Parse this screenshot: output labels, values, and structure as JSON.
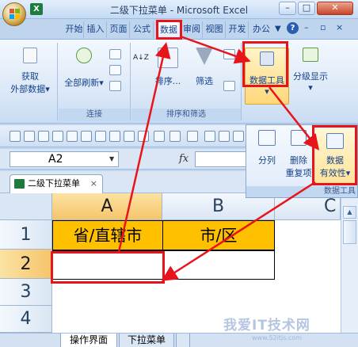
{
  "window": {
    "title": "二级下拉菜单 - Microsoft Excel",
    "min_glyph": "–",
    "max_glyph": "□",
    "close_glyph": "✕",
    "qat_glyph": "X"
  },
  "ribbon_tabs": [
    {
      "label": "开始"
    },
    {
      "label": "插入"
    },
    {
      "label": "页面"
    },
    {
      "label": "公式"
    },
    {
      "label": "数据",
      "active": true
    },
    {
      "label": "审阅"
    },
    {
      "label": "视图"
    },
    {
      "label": "开发"
    },
    {
      "label": "办公"
    }
  ],
  "tab_more_glyph": "▼",
  "help_glyph": "?",
  "tab_controls": {
    "min": "–",
    "restore": "▫",
    "close": "×"
  },
  "ribbon": {
    "get_data": {
      "line1": "获取",
      "line2": "外部数据",
      "arrow": "▾"
    },
    "refresh_all": {
      "label": "全部刷新",
      "arrow": "▾"
    },
    "connections_group": "连接",
    "sort_az": "A↓Z",
    "sort_label": "排序...",
    "filter_label": "筛选",
    "sort_filter_group": "排序和筛选",
    "data_tools": {
      "label": "数据工具",
      "arrow": "▾"
    },
    "outline": {
      "label": "分级显示",
      "arrow": "▾"
    }
  },
  "name_box": {
    "value": "A2",
    "arrow": "▼"
  },
  "formula_bar": {
    "fx": "fx",
    "value": ""
  },
  "workbook_tab": {
    "label": "二级下拉菜单",
    "close": "×"
  },
  "data_tools_panel": {
    "text_to_columns": "分列",
    "remove_duplicates_line1": "删除",
    "remove_duplicates_line2": "重复项",
    "data_validation_line1": "数据",
    "data_validation_line2": "有效性",
    "data_validation_arrow": "▾",
    "group_label": "数据工具"
  },
  "grid": {
    "columns": [
      "A",
      "B",
      "C"
    ],
    "rows": [
      "1",
      "2",
      "3",
      "4"
    ],
    "cells": {
      "A1": "省/直辖市",
      "B1": "市/区",
      "A2": "",
      "B2": ""
    }
  },
  "sheet_tabs": [
    {
      "label": "操作界面",
      "active": true
    },
    {
      "label": "下拉菜单",
      "active": false
    }
  ],
  "scroll": {
    "up": "▲"
  },
  "watermark": {
    "text": "我爱IT技术网",
    "sub": "www.52itjs.com"
  },
  "colors": {
    "annotation": "#e8141c",
    "header_fill": "#ffc000",
    "selected_header": "#f6c46b"
  }
}
